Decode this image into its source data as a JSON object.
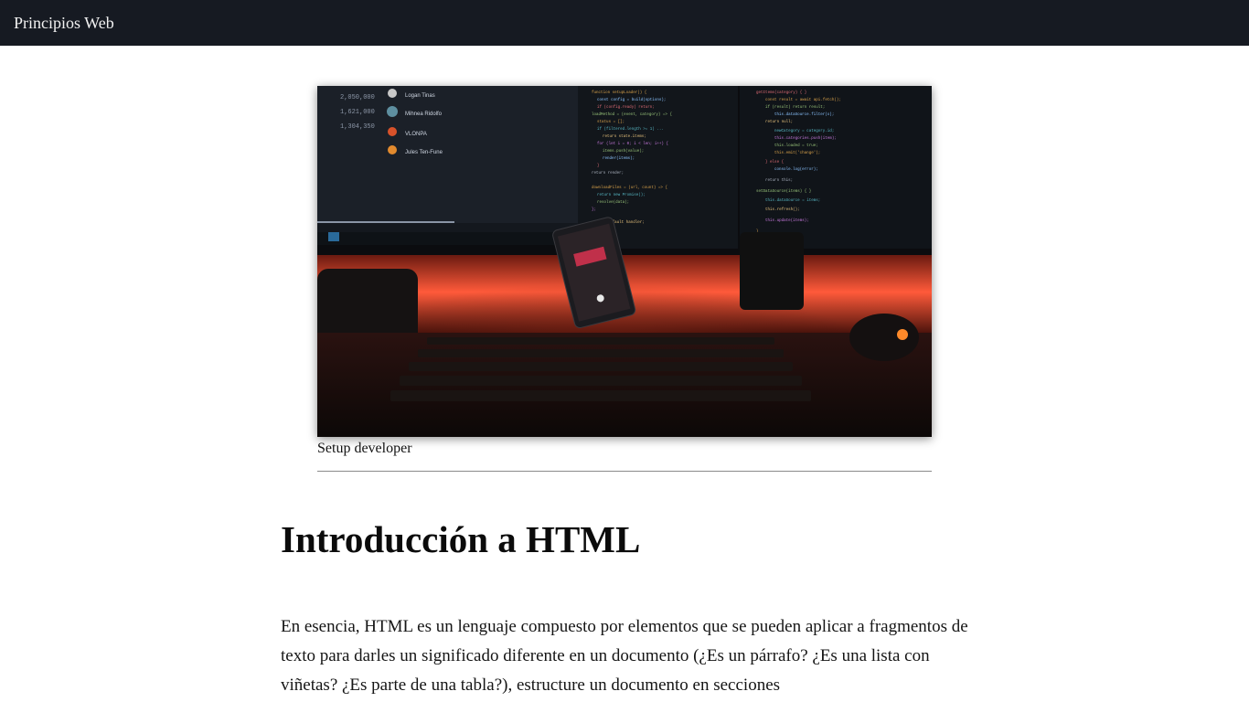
{
  "header": {
    "brand": "Principios Web",
    "background": "#161a22"
  },
  "figure": {
    "image_description_icon": "image-developer-setup",
    "caption": "Setup developer"
  },
  "article": {
    "title": "Introducción a HTML",
    "paragraph": "En esencia, HTML es un lenguaje compuesto por elementos que se pueden aplicar a fragmentos de texto para darles un significado diferente en un documento (¿Es un párrafo? ¿Es una lista con viñetas? ¿Es parte de una tabla?), estructure un documento en secciones"
  }
}
